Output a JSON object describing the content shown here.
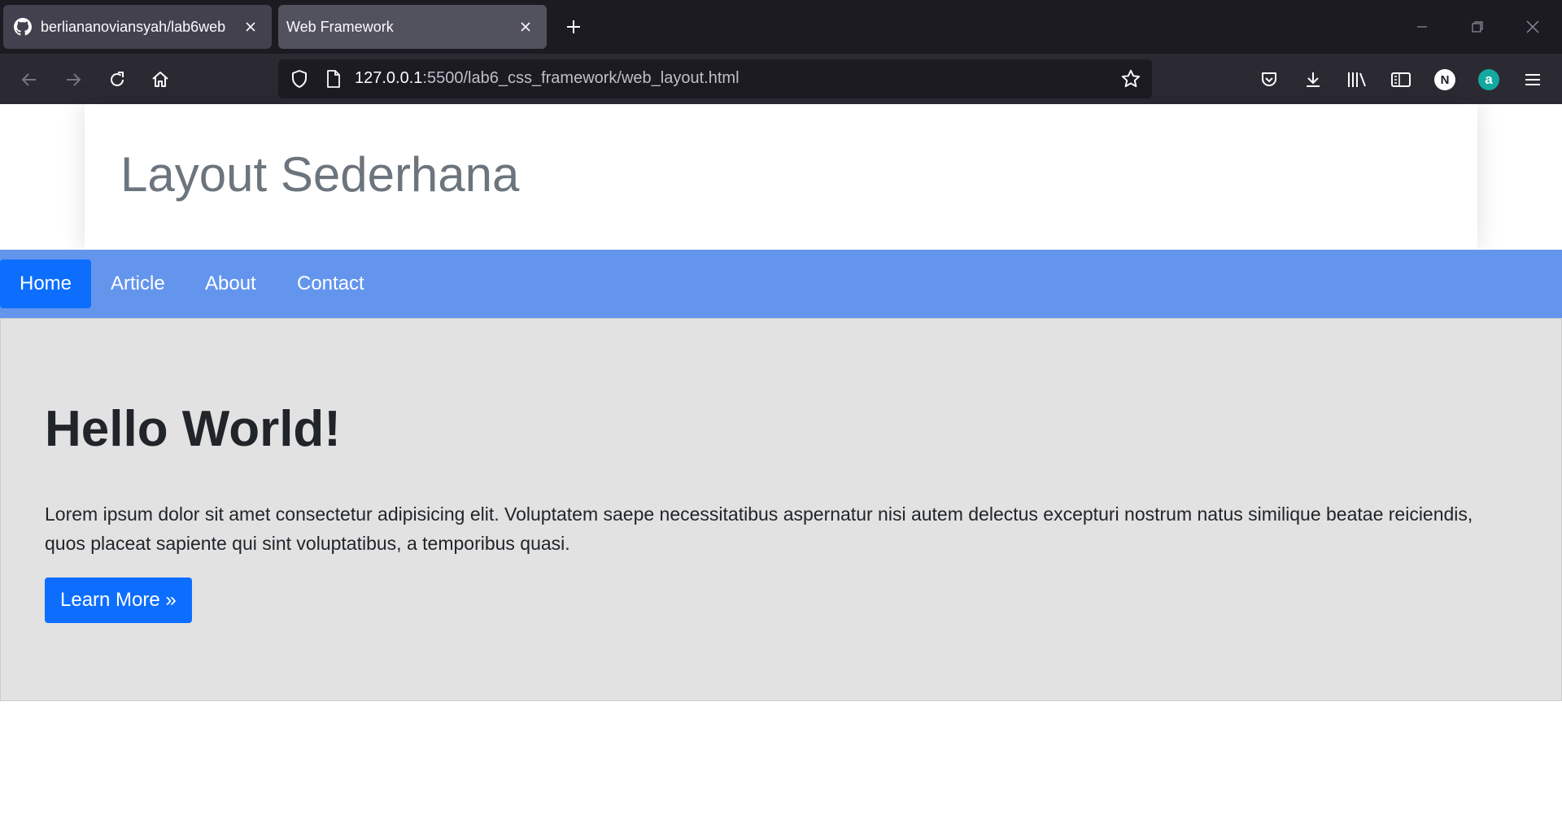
{
  "browser": {
    "tabs": [
      {
        "title": "berliananoviansyah/lab6web",
        "favicon": "github-icon",
        "active": false
      },
      {
        "title": "Web Framework",
        "favicon": "",
        "active": true
      }
    ],
    "url_host": "127.0.0.1",
    "url_rest": ":5500/lab6_css_framework/web_layout.html",
    "profile_initial": "N",
    "extension_initial": "a"
  },
  "page": {
    "site_title": "Layout Sederhana",
    "nav": [
      {
        "label": "Home",
        "active": true
      },
      {
        "label": "Article",
        "active": false
      },
      {
        "label": "About",
        "active": false
      },
      {
        "label": "Contact",
        "active": false
      }
    ],
    "hero": {
      "title": "Hello World!",
      "text": "Lorem ipsum dolor sit amet consectetur adipisicing elit. Voluptatem saepe necessitatibus aspernatur nisi autem delectus excepturi nostrum natus similique beatae reiciendis, quos placeat sapiente qui sint voluptatibus, a temporibus quasi.",
      "button": "Learn More »"
    }
  },
  "colors": {
    "nav_bg": "#6495ed",
    "primary": "#0d6efd",
    "jumbotron_bg": "#e2e2e2",
    "title_gray": "#6c757d",
    "chrome_dark": "#1c1b22",
    "chrome_toolbar": "#2b2a33"
  }
}
